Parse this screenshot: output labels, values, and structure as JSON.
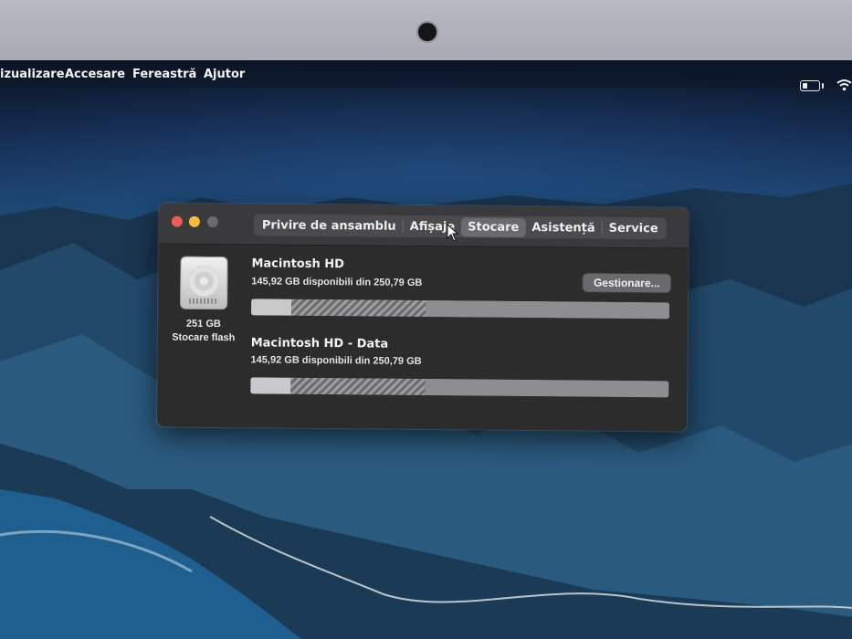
{
  "menubar": {
    "items": [
      "izualizare",
      "Accesare",
      "Fereastră",
      "Ajutor"
    ],
    "status_icons": [
      "battery-icon",
      "wifi-icon"
    ]
  },
  "window": {
    "tabs": [
      {
        "label": "Privire de ansamblu",
        "active": false
      },
      {
        "label": "Afișaje",
        "active": false
      },
      {
        "label": "Stocare",
        "active": true
      },
      {
        "label": "Asistență",
        "active": false
      },
      {
        "label": "Service",
        "active": false
      }
    ],
    "disk": {
      "icon": "hard-disk-icon",
      "size": "251 GB",
      "type": "Stocare flash"
    },
    "manage_label": "Gestionare...",
    "volumes": [
      {
        "name": "Macintosh HD",
        "availability": "145,92 GB disponibili din 250,79 GB",
        "used_fraction": 0.418
      },
      {
        "name": "Macintosh HD - Data",
        "availability": "145,92 GB disponibili din 250,79 GB",
        "used_fraction": 0.418
      }
    ]
  },
  "colors": {
    "close": "#ee5b52",
    "minimize": "#f3be3c",
    "window_bg": "#2d2c2d"
  }
}
